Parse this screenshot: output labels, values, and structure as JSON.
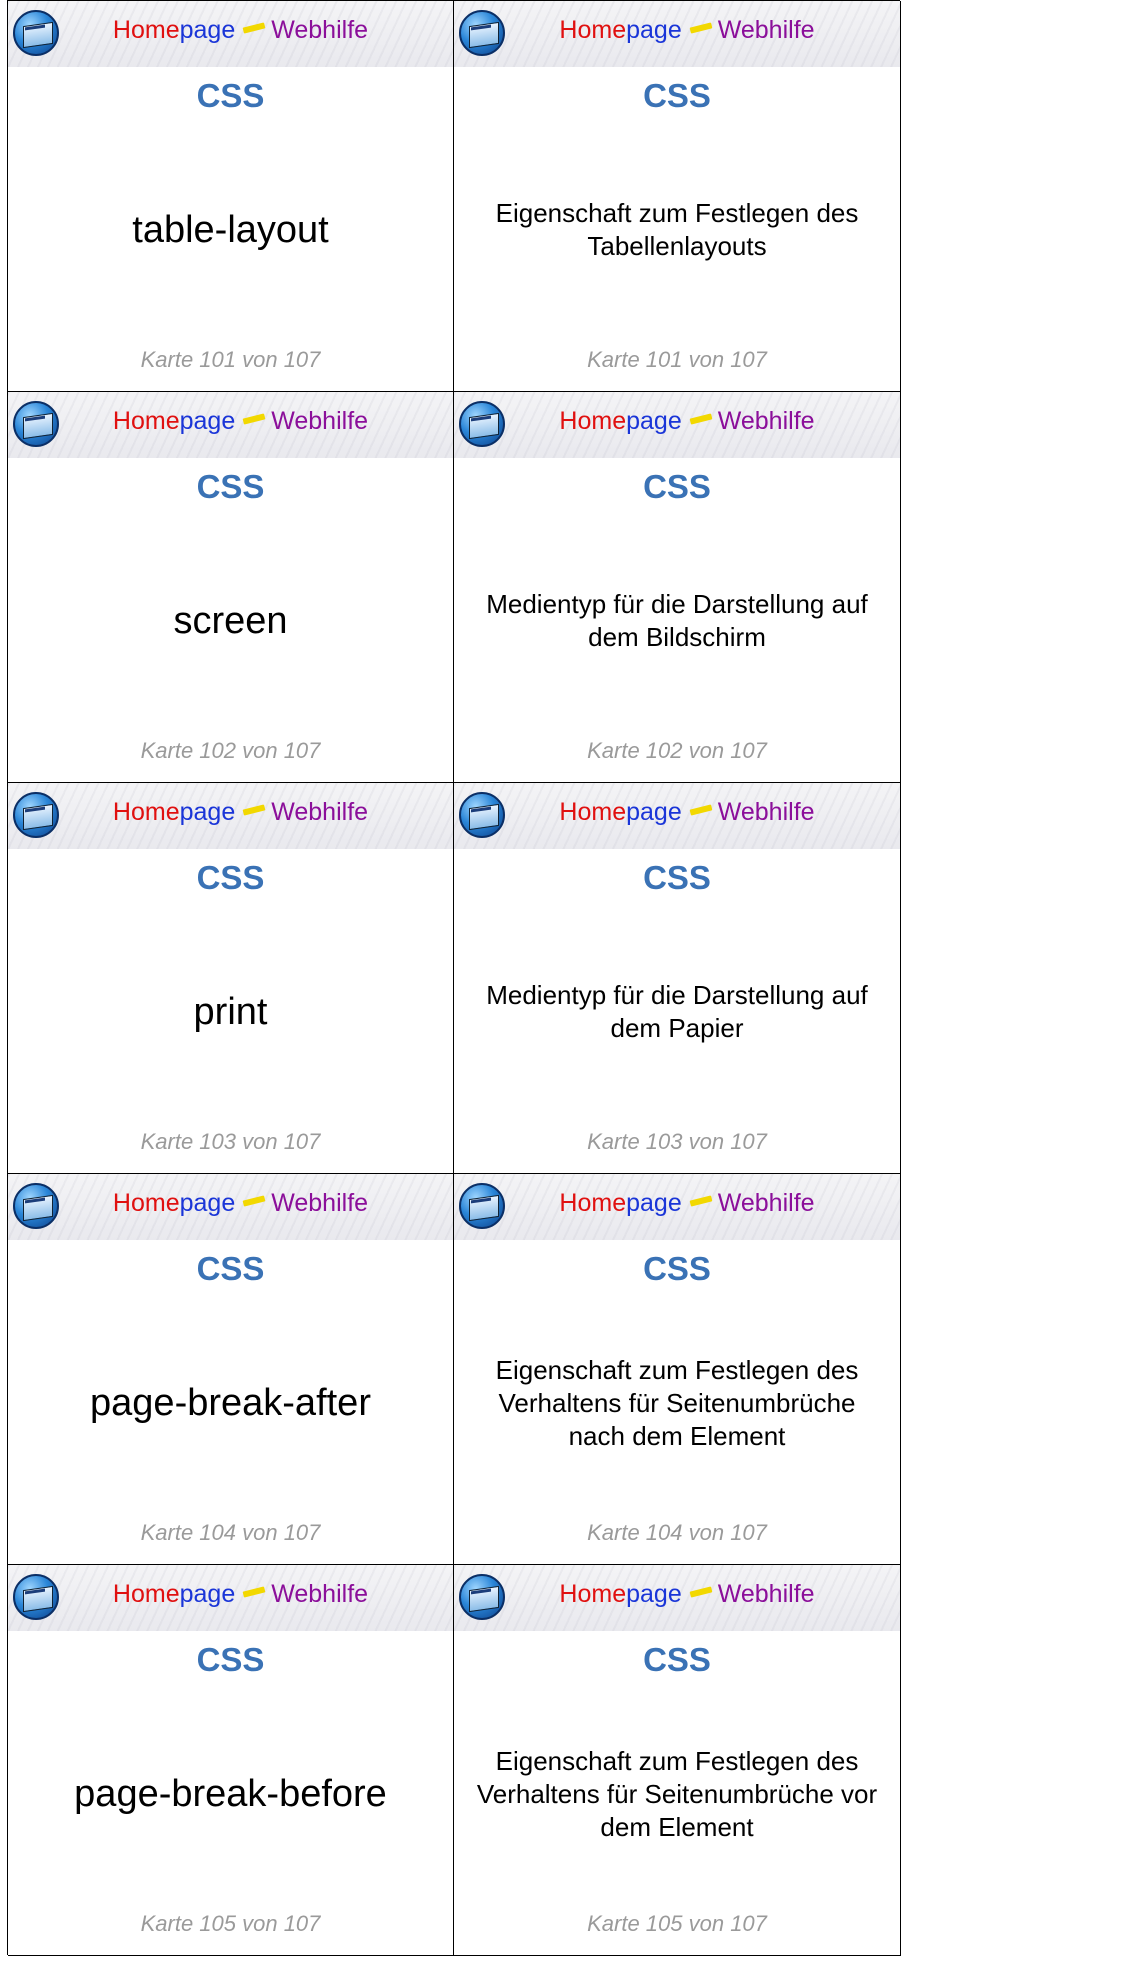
{
  "brand": {
    "home": "Home",
    "page": "page",
    "web": "Webhilfe"
  },
  "category": "CSS",
  "rows": [
    {
      "term": "table-layout",
      "description": "Eigenschaft zum Festlegen des Tabellenlayouts",
      "footer": "Karte 101 von 107"
    },
    {
      "term": "screen",
      "description": "Medientyp für die Darstellung auf dem Bildschirm",
      "footer": "Karte 102 von 107"
    },
    {
      "term": "print",
      "description": "Medientyp für die Darstellung auf dem Papier",
      "footer": "Karte 103 von 107"
    },
    {
      "term": "page-break-after",
      "description": "Eigenschaft zum Festlegen des Verhaltens für Seitenumbrüche nach dem Element",
      "footer": "Karte 104 von 107"
    },
    {
      "term": "page-break-before",
      "description": "Eigenschaft zum Festlegen des Verhaltens für Seitenumbrüche vor dem Element",
      "footer": "Karte 105 von 107"
    }
  ]
}
